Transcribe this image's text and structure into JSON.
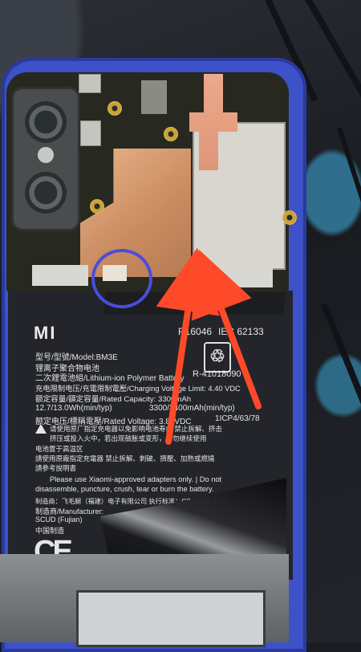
{
  "battery_label": {
    "brand": "MI",
    "model_line": "型号/型號/Model:BM3E",
    "cn_line1": "锂离子聚合物电池",
    "cn_line2": "二次鋰電池組/Lithium-ion Polymer Battery",
    "cert_top": "IEC 62133",
    "cert_left": "R16046",
    "reg_number": "R-41018090",
    "charging_line": "充电限制电压/充電限制電壓/Charging Voltage Limit: 4.40 VDC",
    "capacity_line": "额定容量/額定容量/Rated Capacity: 3300mAh",
    "wh_line": "12.7/13.0Wh(min/typ)",
    "mah_line": "3300/3400mAh(min/typ)",
    "voltage_line": "额定电压/標稱電壓/Rated Voltage: 3.85VDC",
    "cell_code": "1ICP4/63/78",
    "warning_cn1": "请使用原厂指定充电器以免影响电池寿命 禁止拆解、挤击",
    "warning_cn2": "挤压或投入火中，若出现鼓胀或变形，请勿继续使用",
    "warning_cn3": "电池置于高温区",
    "warning_cn4": "請使用原廠指定充電器 禁止拆解、刺破、擠壓、加熱或燃燒",
    "warning_cn5": "請參考說明書",
    "adapter_en1": "Please use Xiaomi-approved adapters only. | Do not",
    "adapter_en2": "disassemble, puncture, crush, tear or burn the battery.",
    "maker_line": "制造商：飞毛腿（福建）电子有限公司 执行标准：GB 31241-2014",
    "manufacturer_line": "制造商/Manufacturer:",
    "scud_line": "SCUD (Fujian)",
    "made_in": "中国制造",
    "ce_mark": "CE"
  },
  "annotations": {
    "circle_color": "#4a4ddc",
    "arrow_color": "#ff4a2a"
  },
  "phone": {
    "back_color": "#3d52c8"
  }
}
